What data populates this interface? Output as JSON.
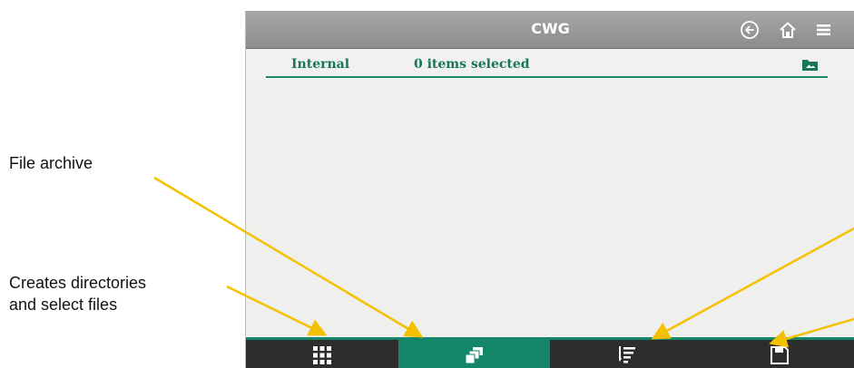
{
  "titlebar": {
    "title": "CWG",
    "icons": [
      "back-icon",
      "home-icon",
      "menu-icon"
    ]
  },
  "infobar": {
    "location": "Internal",
    "selection": "0 items selected",
    "icon": "folder-image-icon"
  },
  "bottom_tabs": [
    {
      "icon": "grid-icon",
      "active": false
    },
    {
      "icon": "file-stack-icon",
      "active": true
    },
    {
      "icon": "sort-icon",
      "active": false
    },
    {
      "icon": "save-icon",
      "active": false
    }
  ],
  "annotations": {
    "file_archive": "File archive",
    "creates_line1": "Creates directories",
    "creates_line2": "and select files"
  },
  "colors": {
    "accent": "#14866a",
    "titlebar": "#9a9a9a",
    "bottombar": "#2d2d2d",
    "arrow": "#f5c000"
  }
}
